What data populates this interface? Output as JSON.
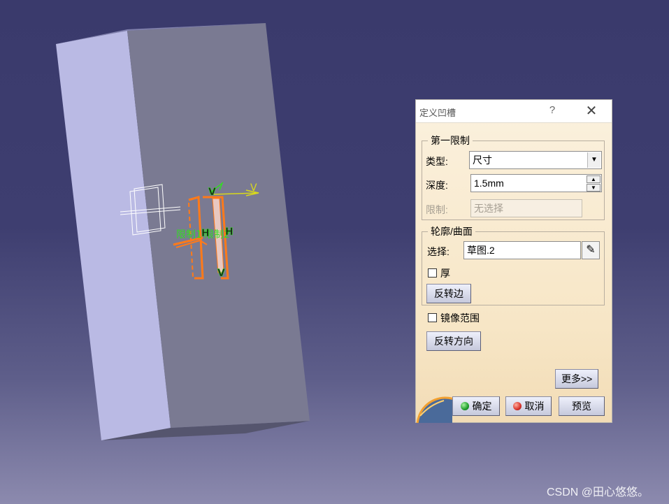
{
  "viewport": {
    "annotations": {
      "limit1": "限制1",
      "limit2": "限制2",
      "v_top": "V",
      "v_bottom": "V",
      "h_left": "H",
      "h_right": "H",
      "axis_v": "V"
    }
  },
  "dialog": {
    "title": "定义凹槽",
    "help_label": "?",
    "close_label": "✕",
    "first_limit": {
      "legend": "第一限制",
      "type_label": "类型:",
      "type_value": "尺寸",
      "depth_label": "深度:",
      "depth_value": "1.5mm",
      "limit_label": "限制:",
      "limit_value": "无选择"
    },
    "profile": {
      "legend": "轮廓/曲面",
      "select_label": "选择:",
      "select_value": "草图.2",
      "thick_label": "厚",
      "thick_checked": false,
      "reverse_side_label": "反转边"
    },
    "mirror_label": "镜像范围",
    "mirror_checked": false,
    "reverse_direction_label": "反转方向",
    "more_label": "更多>>",
    "ok_label": "确定",
    "cancel_label": "取消",
    "preview_label": "预览"
  },
  "watermark": "CSDN @田心悠悠。",
  "colors": {
    "accent_orange": "#ff7a1a",
    "annotation_green": "#33dd22",
    "axis_yellow": "#d8d81c",
    "block_light": "#babae4",
    "block_dark": "#7a7a92"
  }
}
